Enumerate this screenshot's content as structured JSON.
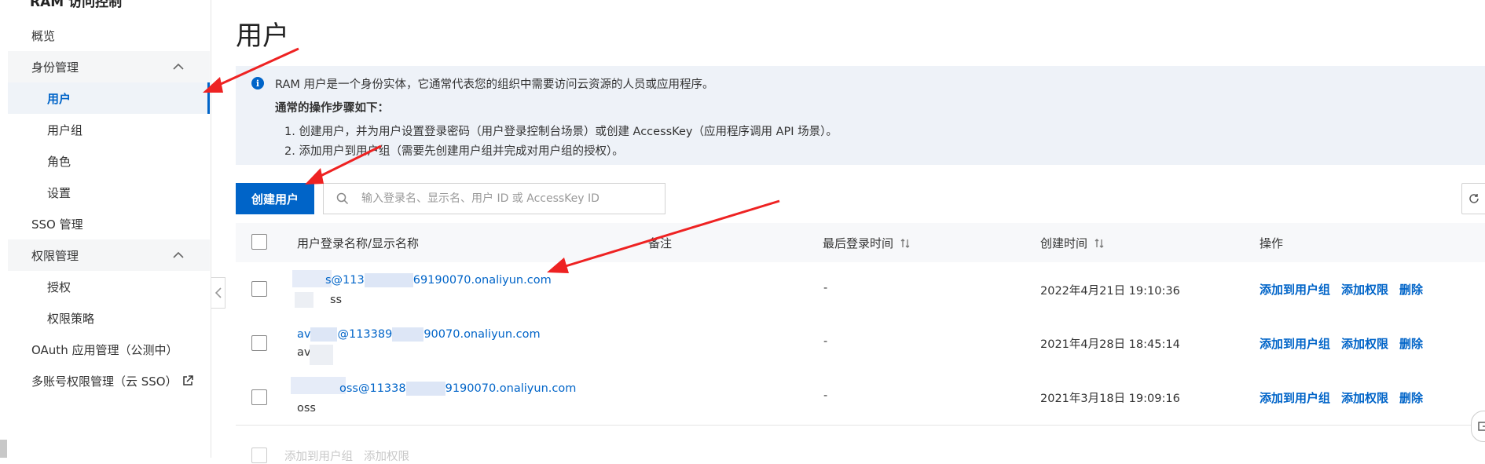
{
  "sidebar": {
    "top_cut_title": "RAM 访问控制",
    "items": [
      {
        "label": "概览"
      },
      {
        "label": "身份管理"
      },
      {
        "label": "用户"
      },
      {
        "label": "用户组"
      },
      {
        "label": "角色"
      },
      {
        "label": "设置"
      },
      {
        "label": "SSO 管理"
      },
      {
        "label": "权限管理"
      },
      {
        "label": "授权"
      },
      {
        "label": "权限策略"
      },
      {
        "label": "OAuth 应用管理（公测中）"
      },
      {
        "label": "多账号权限管理（云 SSO）"
      }
    ]
  },
  "page": {
    "title": "用户"
  },
  "info": {
    "line1": "RAM 用户是一个身份实体，它通常代表您的组织中需要访问云资源的人员或应用程序。",
    "line2": "通常的操作步骤如下：",
    "line3": "1. 创建用户，并为用户设置登录密码（用户登录控制台场景）或创建 AccessKey（应用程序调用 API 场景）。",
    "line4": "2. 添加用户到用户组（需要先创建用户组并完成对用户组的授权）。"
  },
  "toolbar": {
    "create_label": "创建用户",
    "search_placeholder": "输入登录名、显示名、用户 ID 或 AccessKey ID"
  },
  "table": {
    "headers": {
      "name": "用户登录名称/显示名称",
      "remark": "备注",
      "last_login": "最后登录时间",
      "created": "创建时间",
      "actions": "操作"
    },
    "rows": [
      {
        "login_prefix": "s@113",
        "login_suffix": "69190070.onaliyun.com",
        "display": "ss",
        "last_login": "-",
        "created": "2022年4月21日 19:10:36"
      },
      {
        "login_prefix": "av",
        "login_mid": "@113389",
        "login_suffix": "90070.onaliyun.com",
        "display": "av",
        "last_login": "-",
        "created": "2021年4月28日 18:45:14"
      },
      {
        "login_prefix": "oss@11338",
        "login_suffix": "9190070.onaliyun.com",
        "display": "oss",
        "last_login": "-",
        "created": "2021年3月18日 19:09:16"
      }
    ],
    "actions": {
      "add_group": "添加到用户组",
      "add_perm": "添加权限",
      "delete": "删除"
    }
  },
  "footer": {
    "add_group": "添加到用户组",
    "add_perm": "添加权限"
  },
  "colors": {
    "primary": "#0064c8",
    "annotation": "#ee2222"
  }
}
